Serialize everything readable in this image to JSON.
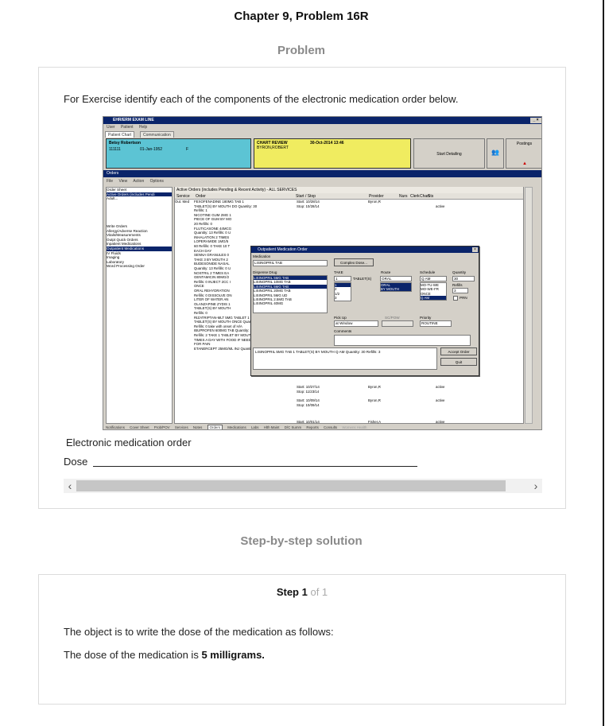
{
  "header": {
    "chapter_title": "Chapter 9, Problem 16R"
  },
  "problem": {
    "heading": "Problem",
    "text": "For Exercise identify each of the components of the electronic medication order below.",
    "figure_caption": "Electronic medication order",
    "dose_label": "Dose",
    "scroll_left_icon": "chevron-left-icon",
    "scroll_right_icon": "chevron-right-icon"
  },
  "ehr": {
    "window_title": "EHR/ERM EXAM LINE",
    "menu": [
      "User",
      "Patient",
      "Help"
    ],
    "tabs": [
      "Patient Chart",
      "Communication"
    ],
    "patient_name": "Betsy Robertson",
    "patient_id": "111111",
    "patient_dob": "01-Jan-1952",
    "patient_sex": "F",
    "chart_review": "CHART REVIEW",
    "review_date": "30-Oct-2014 13:46",
    "reviewer": "BYRON,ROBERT",
    "start_detailing": "Start Detailing",
    "postings": "Postings",
    "orders_title": "Orders",
    "orders_menu": [
      "File",
      "View",
      "Action",
      "Options"
    ],
    "left_pane": [
      "Order Sheet",
      "Active Orders (includes Pendi",
      "Adult...",
      "",
      "",
      "Write Orders",
      "Allergy/Adverse Reaction",
      "Vitals/Measurements",
      "Outpt Quick Orders",
      "Inpatient Medications",
      "Outpatient Medications",
      "IV Fluids",
      "Imaging",
      "Laboratory",
      "Word Processing Order"
    ],
    "orders_header": "Active Orders (includes Pending & Recent Activity) - ALL SERVICES",
    "columns": [
      "Service",
      "Order",
      "Start / Stop",
      "Provider",
      "Nurs",
      "Clerk",
      "Chart",
      "Sts"
    ],
    "orders": [
      {
        "service": "Out. Med",
        "order": "FEXOFENADINE 180MG TAB 1"
      },
      {
        "service": "",
        "order": "TABLET(S) BY MOUTH DO Quantity: 30"
      },
      {
        "service": "",
        "order": "Refills: 1"
      },
      {
        "service": "",
        "order": "NICOTINE GUM 2MG 1"
      },
      {
        "service": "",
        "order": "PIECE OF GUM BY MO"
      },
      {
        "service": "",
        "order": "20 Refills: 0"
      },
      {
        "service": "",
        "order": "FLUTICASONE 44MCG"
      },
      {
        "service": "",
        "order": "Quantity: 13 Refills: 0 U"
      },
      {
        "service": "",
        "order": "INHALATION 2 TIMES"
      },
      {
        "service": "",
        "order": "LOPERAMIDE 1MG/5"
      },
      {
        "service": "",
        "order": "60 Refills: 0 TAKE 10 T"
      },
      {
        "service": "",
        "order": "EACH DAY"
      },
      {
        "service": "",
        "order": "SENNA GRANULES 0"
      },
      {
        "service": "",
        "order": "TAKE 3 BY MOUTH 2"
      },
      {
        "service": "",
        "order": "BUDESONIDE NASAL"
      },
      {
        "service": "",
        "order": "Quantity: 13 Refills: 0 U"
      },
      {
        "service": "",
        "order": "NOSTRIL 2 TIMES EA"
      },
      {
        "service": "",
        "order": "GENTAMICIN 80MG/2"
      },
      {
        "service": "",
        "order": "Refills: 0 INJECT 2CC I"
      },
      {
        "service": "",
        "order": "ONCE"
      },
      {
        "service": "",
        "order": "ORAL REHYDRATION"
      },
      {
        "service": "",
        "order": "Refills: 0 DISSOLVE ON"
      },
      {
        "service": "",
        "order": "LITER OF WATER AN"
      },
      {
        "service": "",
        "order": "OLANZAPINE ZYDIS 1"
      },
      {
        "service": "",
        "order": "TABLET(S) BY MOUTH"
      },
      {
        "service": "",
        "order": "Refills: 0"
      },
      {
        "service": "",
        "order": "RIZATRIPTAN-MLT 5MG TABLET 1"
      },
      {
        "service": "",
        "order": "TABLET(S) BY MOUTH ONCE Quantity: 6"
      },
      {
        "service": "",
        "order": "Refills: 0 take with onset of H/A"
      },
      {
        "service": "",
        "order": "IBUPROFEN 600MG TAB Quantity: 20"
      },
      {
        "service": "",
        "order": "Refills: 2 TAKE 1 TABLET BY MOUTH 3"
      },
      {
        "service": "",
        "order": "TIMES A DAY WITH FOOD IF NEEDED"
      },
      {
        "service": "",
        "order": "FOR PAIN"
      },
      {
        "service": "",
        "order": "ETANERCEPT 25MG/ML INJ Quantity: 1"
      }
    ],
    "provider_rows": [
      {
        "start": "Start: 10/28/14",
        "stop": "Stop: 10/28/14",
        "provider": "Byron,R",
        "status": "active"
      },
      {
        "start": "Start: 10/27/14",
        "stop": "Stop: 11/23/14",
        "provider": "Byron,R",
        "status": "active"
      },
      {
        "start": "Start: 10/09/14",
        "stop": "Stop: 10/09/14",
        "provider": "Byron,R",
        "status": "active"
      },
      {
        "start": "Start: 10/01/14",
        "stop": "",
        "provider": "Fisher,A",
        "status": "active"
      }
    ],
    "dialog": {
      "title": "Outpatient Medication Order",
      "medication_label": "Medication",
      "medication_value": "LISINOPRIL TAB",
      "complex_dose": "Complex Dose...",
      "dispense_label": "Dispense Drug",
      "dispense_items": [
        "LISINOPRIL 5MG TAB",
        "LISINOPRIL 10MG TAB",
        "LISINOPRIL 5MG TAB",
        "LISINOPRIL 20MG TAB",
        "LISINOPRIL 5MG UD",
        "LISINOPRIL 2.5MG TAB",
        "LISINOPRIL 40MG"
      ],
      "take_label": "TAKE",
      "take_value": "1",
      "take_unit": "TABLET(S)",
      "take_options": [
        "1",
        "2",
        "1/2",
        "3"
      ],
      "route_label": "Route",
      "route_value": "ORAL",
      "route_options": [
        "ORAL",
        "BY MOUTH"
      ],
      "schedule_label": "Schedule",
      "schedule_value": "Q AM",
      "schedule_options": [
        "MO-TU-WE",
        "MO-WE-FR",
        "ONCE",
        "Q AM"
      ],
      "quantity_label": "Quantity",
      "quantity_value": "30",
      "refills_label": "Refills",
      "refills_value": "3",
      "prn_label": "PRN",
      "pickup_label": "Pick Up",
      "pickup_value": "at Window",
      "service_label": "SC/POW",
      "priority_label": "Priority",
      "priority_value": "ROUTINE",
      "comments_label": "Comments",
      "summary": "LISINOPRIL 5MG TAB  1 TABLET(S) BY MOUTH Q AM Quantity: 30 Refills: 3",
      "accept_button": "Accept Order",
      "quit_button": "Quit"
    },
    "bottom_tabs": [
      "Notifications",
      "Cover Sheet",
      "Prob/POV",
      "Services",
      "Notes",
      "Orders",
      "Medications",
      "Labs",
      "Hlth Maint",
      "D/C Summ",
      "Reports",
      "Consults",
      "Womens Health"
    ]
  },
  "solution": {
    "heading": "Step-by-step solution",
    "step_word": "Step 1",
    "step_of": "of 1",
    "para1": "The object is to write the dose of the medication as follows:",
    "para2_prefix": "The dose of the medication is ",
    "para2_bold": "5 milligrams."
  }
}
